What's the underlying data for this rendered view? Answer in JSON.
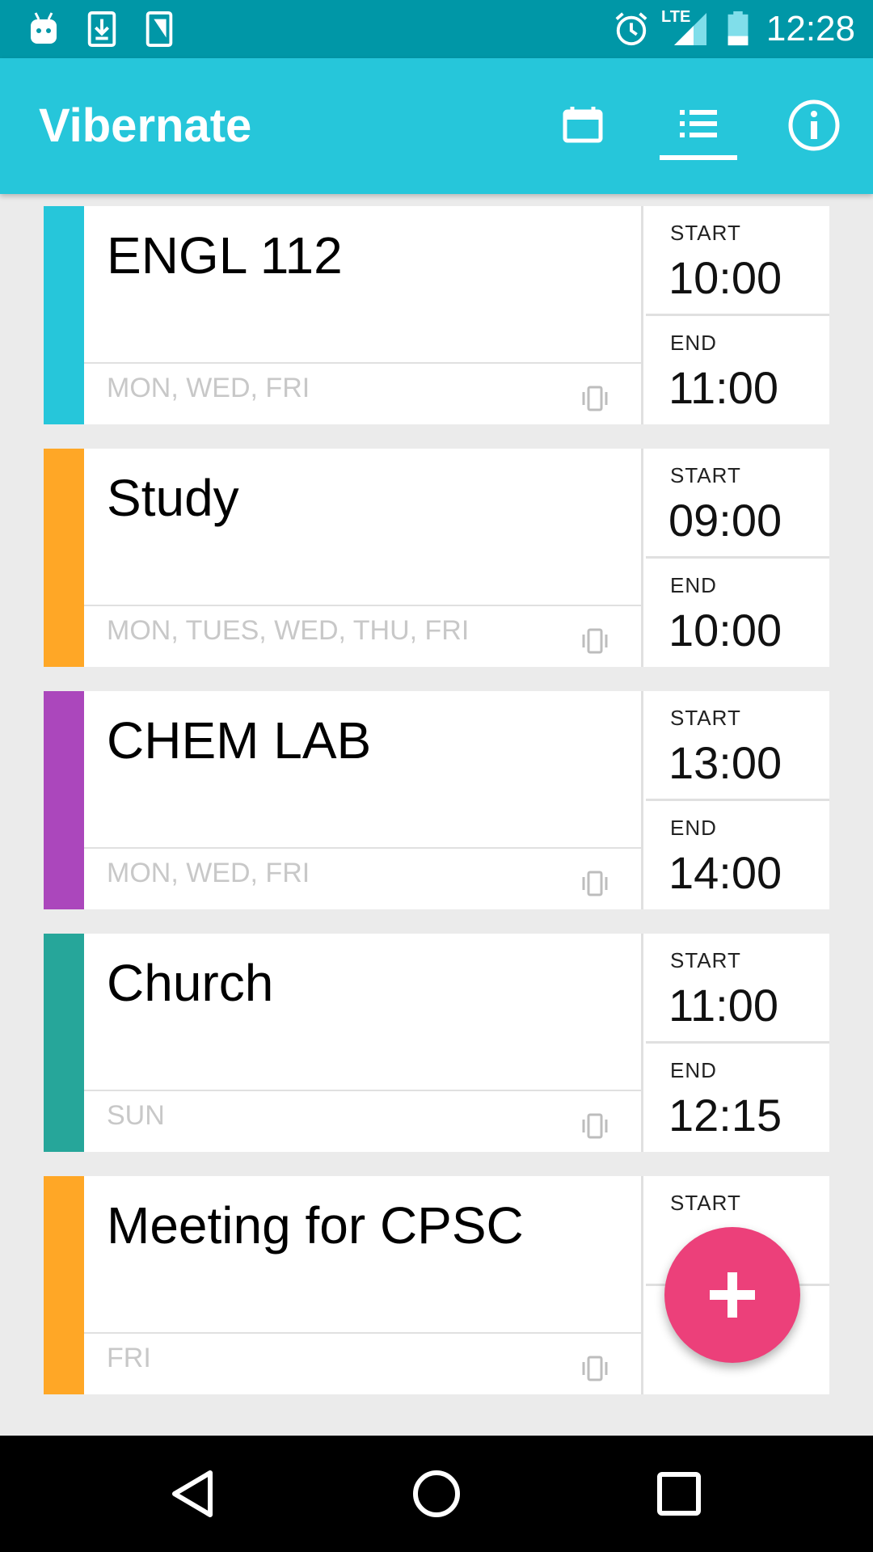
{
  "status_bar": {
    "time": "12:28",
    "network": "LTE",
    "icons": [
      "android-debug-icon",
      "download-icon",
      "sim-card-icon",
      "alarm-icon",
      "signal-icon",
      "battery-icon"
    ]
  },
  "app_bar": {
    "title": "Vibernate",
    "actions": [
      "calendar-icon",
      "list-icon",
      "info-icon"
    ],
    "selected_action": "list-icon",
    "color": "#26c6da"
  },
  "labels": {
    "start": "START",
    "end": "END"
  },
  "events": [
    {
      "title": "ENGL 112",
      "days": "MON, WED, FRI",
      "start": "10:00",
      "end": "11:00",
      "color": "#26c6da"
    },
    {
      "title": "Study",
      "days": "MON, TUES, WED, THU, FRI",
      "start": "09:00",
      "end": "10:00",
      "color": "#ffa726"
    },
    {
      "title": "CHEM LAB",
      "days": "MON, WED, FRI",
      "start": "13:00",
      "end": "14:00",
      "color": "#ab47bc"
    },
    {
      "title": "Church",
      "days": "SUN",
      "start": "11:00",
      "end": "12:15",
      "color": "#26a69a"
    },
    {
      "title": "Meeting for CPSC",
      "days": "FRI",
      "start": "",
      "end": "",
      "color": "#ffa726"
    }
  ],
  "fab": {
    "icon": "plus-icon",
    "color": "#ec407a"
  },
  "nav_bar": {
    "buttons": [
      "back-icon",
      "home-icon",
      "recents-icon"
    ]
  }
}
